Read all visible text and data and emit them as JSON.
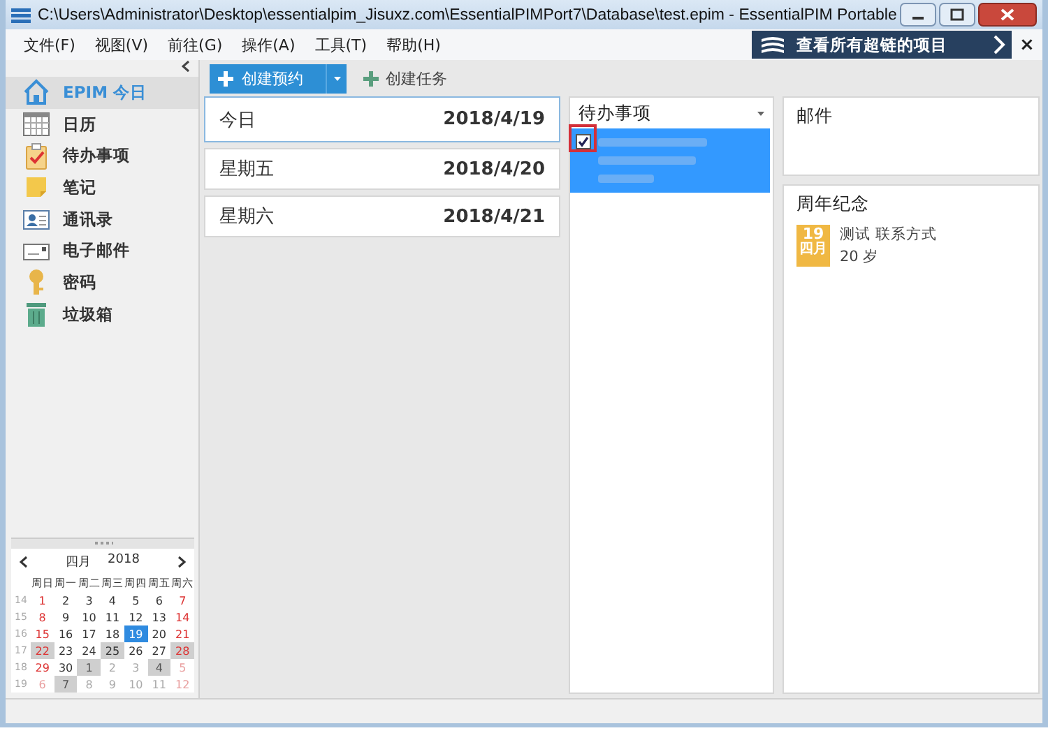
{
  "window": {
    "title": "C:\\Users\\Administrator\\Desktop\\essentialpim_Jisuxz.com\\EssentialPIMPort7\\Database\\test.epim - EssentialPIM Portable"
  },
  "menu": [
    "文件(F)",
    "视图(V)",
    "前往(G)",
    "操作(A)",
    "工具(T)",
    "帮助(H)"
  ],
  "banner": {
    "label": "查看所有超链的项目",
    "close": "×"
  },
  "sidebar": {
    "items": [
      {
        "kind": "today",
        "label": "EPIM 今日",
        "selected": true
      },
      {
        "kind": "calendar",
        "label": "日历",
        "selected": false
      },
      {
        "kind": "tasks",
        "label": "待办事项",
        "selected": false
      },
      {
        "kind": "notes",
        "label": "笔记",
        "selected": false
      },
      {
        "kind": "contacts",
        "label": "通讯录",
        "selected": false
      },
      {
        "kind": "mail",
        "label": "电子邮件",
        "selected": false
      },
      {
        "kind": "passwords",
        "label": "密码",
        "selected": false
      },
      {
        "kind": "trash",
        "label": "垃圾箱",
        "selected": false
      }
    ]
  },
  "toolbar": [
    {
      "kind": "primary",
      "label": "创建预约"
    },
    {
      "kind": "plain",
      "label": "创建任务"
    }
  ],
  "days": [
    {
      "label": "今日",
      "date": "2018/4/19",
      "selected": true
    },
    {
      "label": "星期五",
      "date": "2018/4/20",
      "selected": false
    },
    {
      "label": "星期六",
      "date": "2018/4/21",
      "selected": false
    }
  ],
  "todo": {
    "title": "待办事项",
    "items": [
      {
        "checked": true,
        "selected": true,
        "highlighted": true
      }
    ]
  },
  "mail": {
    "title": "邮件"
  },
  "anniversary": {
    "title": "周年纪念",
    "items": [
      {
        "day": "19",
        "month": "四月",
        "name": "测试 联系方式",
        "age": "20 岁"
      }
    ]
  },
  "mini_calendar": {
    "month": "四月",
    "year": "2018",
    "weekdays": [
      "周日",
      "周一",
      "周二",
      "周三",
      "周四",
      "周五",
      "周六"
    ],
    "weeks": [
      {
        "number": "14",
        "days": [
          {
            "label": "1",
            "kind": "current",
            "marked": false,
            "selected": false
          },
          {
            "label": "2",
            "kind": "current",
            "marked": false,
            "selected": false
          },
          {
            "label": "3",
            "kind": "current",
            "marked": false,
            "selected": false
          },
          {
            "label": "4",
            "kind": "current",
            "marked": false,
            "selected": false
          },
          {
            "label": "5",
            "kind": "current",
            "marked": false,
            "selected": false
          },
          {
            "label": "6",
            "kind": "current",
            "marked": false,
            "selected": false
          },
          {
            "label": "7",
            "kind": "current",
            "marked": false,
            "selected": false
          }
        ]
      },
      {
        "number": "15",
        "days": [
          {
            "label": "8",
            "kind": "current",
            "marked": false,
            "selected": false
          },
          {
            "label": "9",
            "kind": "current",
            "marked": false,
            "selected": false
          },
          {
            "label": "10",
            "kind": "current",
            "marked": false,
            "selected": false
          },
          {
            "label": "11",
            "kind": "current",
            "marked": false,
            "selected": false
          },
          {
            "label": "12",
            "kind": "current",
            "marked": false,
            "selected": false
          },
          {
            "label": "13",
            "kind": "current",
            "marked": false,
            "selected": false
          },
          {
            "label": "14",
            "kind": "current",
            "marked": false,
            "selected": false
          }
        ]
      },
      {
        "number": "16",
        "days": [
          {
            "label": "15",
            "kind": "current",
            "marked": false,
            "selected": false
          },
          {
            "label": "16",
            "kind": "current",
            "marked": false,
            "selected": false
          },
          {
            "label": "17",
            "kind": "current",
            "marked": false,
            "selected": false
          },
          {
            "label": "18",
            "kind": "current",
            "marked": false,
            "selected": false
          },
          {
            "label": "19",
            "kind": "current",
            "marked": false,
            "selected": true
          },
          {
            "label": "20",
            "kind": "current",
            "marked": false,
            "selected": false
          },
          {
            "label": "21",
            "kind": "current",
            "marked": false,
            "selected": false
          }
        ]
      },
      {
        "number": "17",
        "days": [
          {
            "label": "22",
            "kind": "current",
            "marked": true,
            "selected": false
          },
          {
            "label": "23",
            "kind": "current",
            "marked": false,
            "selected": false
          },
          {
            "label": "24",
            "kind": "current",
            "marked": false,
            "selected": false
          },
          {
            "label": "25",
            "kind": "current",
            "marked": true,
            "selected": false
          },
          {
            "label": "26",
            "kind": "current",
            "marked": false,
            "selected": false
          },
          {
            "label": "27",
            "kind": "current",
            "marked": false,
            "selected": false
          },
          {
            "label": "28",
            "kind": "current",
            "marked": true,
            "selected": false
          }
        ]
      },
      {
        "number": "18",
        "days": [
          {
            "label": "29",
            "kind": "current",
            "marked": false,
            "selected": false
          },
          {
            "label": "30",
            "kind": "current",
            "marked": false,
            "selected": false
          },
          {
            "label": "1",
            "kind": "other",
            "marked": true,
            "selected": false
          },
          {
            "label": "2",
            "kind": "other",
            "marked": false,
            "selected": false
          },
          {
            "label": "3",
            "kind": "other",
            "marked": false,
            "selected": false
          },
          {
            "label": "4",
            "kind": "other",
            "marked": true,
            "selected": false
          },
          {
            "label": "5",
            "kind": "other",
            "marked": false,
            "selected": false
          }
        ]
      },
      {
        "number": "19",
        "days": [
          {
            "label": "6",
            "kind": "other",
            "marked": false,
            "selected": false
          },
          {
            "label": "7",
            "kind": "other",
            "marked": true,
            "selected": false
          },
          {
            "label": "8",
            "kind": "other",
            "marked": false,
            "selected": false
          },
          {
            "label": "9",
            "kind": "other",
            "marked": false,
            "selected": false
          },
          {
            "label": "10",
            "kind": "other",
            "marked": false,
            "selected": false
          },
          {
            "label": "11",
            "kind": "other",
            "marked": false,
            "selected": false
          },
          {
            "label": "12",
            "kind": "other",
            "marked": false,
            "selected": false
          }
        ]
      }
    ]
  }
}
